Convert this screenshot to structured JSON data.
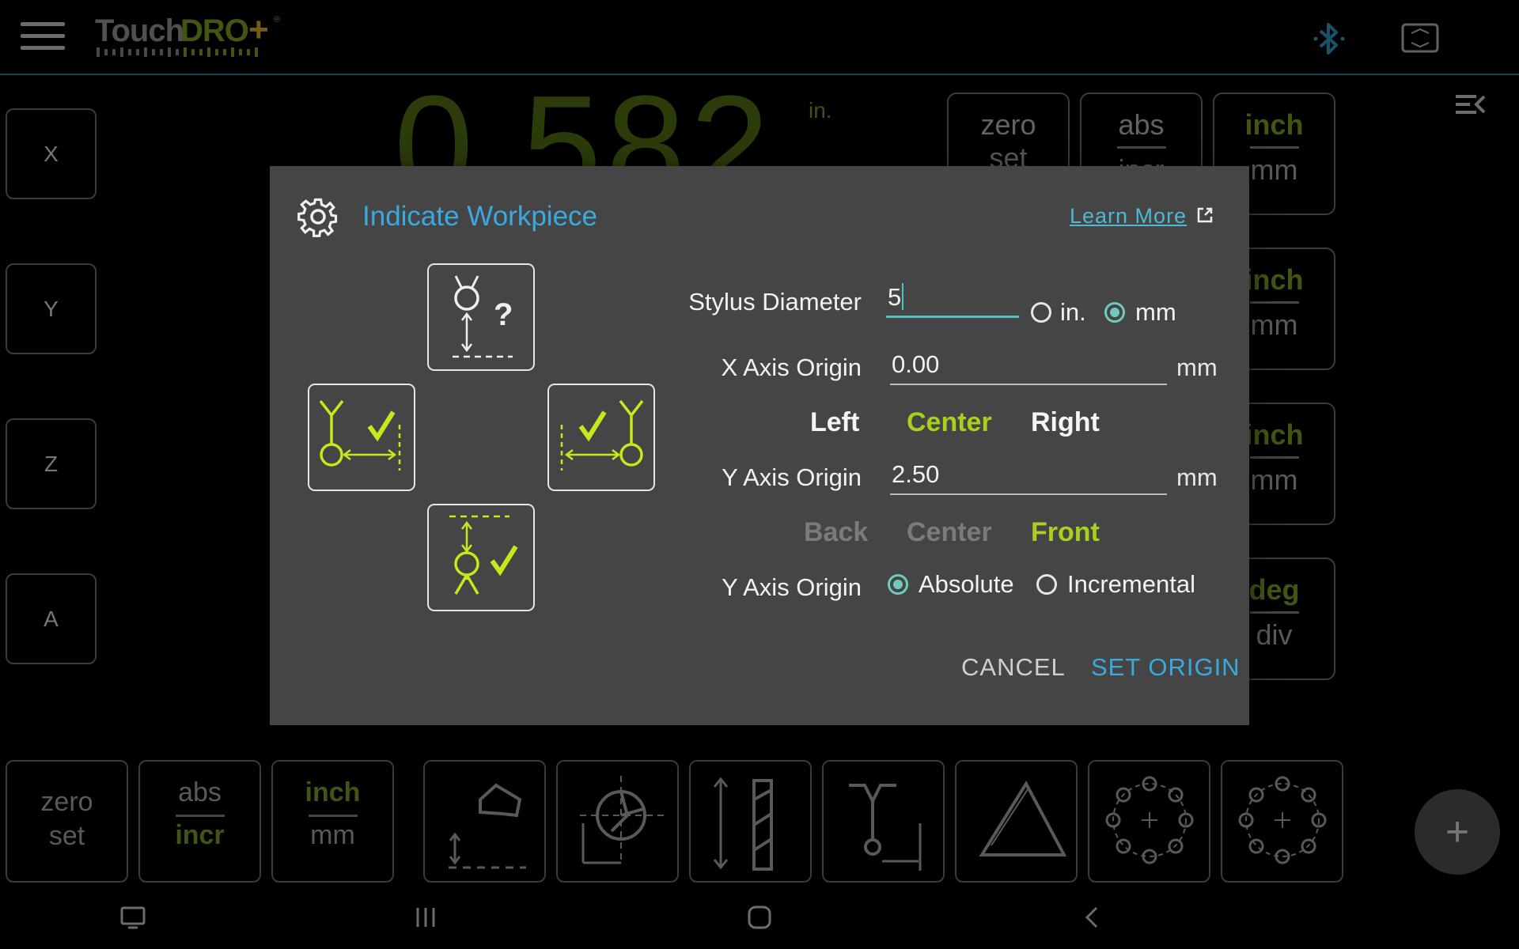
{
  "app": {
    "logo_text": "TouchDRO+"
  },
  "axes": [
    "X",
    "Y",
    "Z",
    "A"
  ],
  "readout": {
    "value": "0.582",
    "unit": "in."
  },
  "side_buttons": [
    {
      "top": "zero",
      "bottom": "set"
    },
    {
      "top": "abs",
      "bottom": "incr"
    },
    {
      "top": "inch",
      "bottom": "mm"
    },
    {
      "top": "inch",
      "bottom": "mm"
    },
    {
      "top": "inch",
      "bottom": "mm"
    },
    {
      "top": "deg",
      "bottom": "div"
    }
  ],
  "toolbar": {
    "zero": {
      "l1": "zero",
      "l2": "set"
    },
    "abs": {
      "top": "abs",
      "bottom": "incr"
    },
    "units": {
      "top": "inch",
      "bottom": "mm"
    },
    "tools": [
      "edge-finder-icon",
      "center-finder-icon",
      "tool-length-icon",
      "workpiece-indicate-icon",
      "angle-measure-icon",
      "bolt-circle-icon",
      "bolt-circle-pattern-icon"
    ],
    "fab_label": "+"
  },
  "dialog": {
    "title": "Indicate Workpiece",
    "learn_more": "Learn More",
    "stylus": {
      "label": "Stylus Diameter",
      "value": "5",
      "unit_in": "in.",
      "unit_mm": "mm",
      "selected": "mm"
    },
    "x_origin": {
      "label": "X Axis Origin",
      "value": "0.00",
      "unit": "mm"
    },
    "x_seg": {
      "left": "Left",
      "center": "Center",
      "right": "Right"
    },
    "y_origin": {
      "label": "Y Axis Origin",
      "value": "2.50",
      "unit": "mm"
    },
    "y_seg": {
      "back": "Back",
      "center": "Center",
      "front": "Front"
    },
    "y_mode": {
      "label": "Y Axis Origin",
      "absolute": "Absolute",
      "incremental": "Incremental",
      "selected": "Absolute"
    },
    "cancel": "CANCEL",
    "set_origin": "SET ORIGIN"
  },
  "colors": {
    "accent_blue": "#3aa9de",
    "accent_green": "#a8d01e",
    "dialog_bg": "#454545"
  }
}
